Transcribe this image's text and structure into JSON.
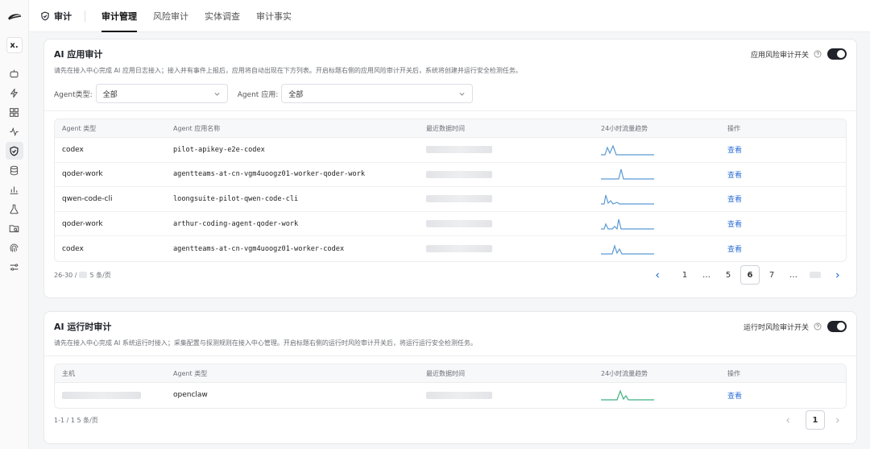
{
  "sidebar": {
    "workspace_initial": "x.",
    "items": [
      {
        "icon": "robot-icon"
      },
      {
        "icon": "lightning-icon"
      },
      {
        "icon": "grid-icon"
      },
      {
        "icon": "activity-icon"
      },
      {
        "icon": "shield-check-icon",
        "active": true
      },
      {
        "icon": "database-icon"
      },
      {
        "icon": "bar-chart-icon"
      },
      {
        "icon": "flask-icon"
      },
      {
        "icon": "folder-search-icon"
      },
      {
        "icon": "fingerprint-icon"
      },
      {
        "icon": "sliders-icon"
      }
    ]
  },
  "header": {
    "module": "审计",
    "tabs": [
      {
        "label": "审计管理",
        "active": true
      },
      {
        "label": "风险审计",
        "active": false
      },
      {
        "label": "实体调查",
        "active": false
      },
      {
        "label": "审计事实",
        "active": false
      }
    ]
  },
  "app_audit": {
    "title": "AI 应用审计",
    "switch_label": "应用风险审计开关",
    "switch_on": true,
    "description": "请先在接入中心完成 AI 应用日志接入；接入并有事件上报后，应用将自动出现在下方列表。开启标题右侧的应用风险审计开关后，系统将创建并运行安全检测任务。",
    "filter_type_label": "Agent类型:",
    "filter_type_value": "全部",
    "filter_app_label": "Agent 应用:",
    "filter_app_value": "全部",
    "columns": [
      "Agent 类型",
      "Agent 应用名称",
      "最近数据时间",
      "24小时流量趋势",
      "操作"
    ],
    "rows": [
      {
        "type": "codex",
        "name": "pilot-apikey-e2e-codex",
        "action": "查看"
      },
      {
        "type": "qoder-work",
        "name": "agentteams-at-cn-vgm4uoogz01-worker-qoder-work",
        "action": "查看"
      },
      {
        "type": "qwen-code-cli",
        "name": "loongsuite-pilot-qwen-code-cli",
        "action": "查看"
      },
      {
        "type": "qoder-work",
        "name": "arthur-coding-agent-qoder-work",
        "action": "查看"
      },
      {
        "type": "codex",
        "name": "agentteams-at-cn-vgm4uoogz01-worker-codex",
        "action": "查看"
      }
    ],
    "total_prefix": "26-30 /",
    "total_suffix": "5 条/页",
    "pages": [
      "1",
      "…",
      "5",
      "6",
      "7",
      "…"
    ],
    "current_page": "6"
  },
  "runtime_audit": {
    "title": "AI 运行时审计",
    "switch_label": "运行时风险审计开关",
    "switch_on": true,
    "description": "请先在接入中心完成 AI 系统运行时接入；采集配置与探测规则在接入中心管理。开启标题右侧的运行时风险审计开关后，将运行运行安全检测任务。",
    "columns": [
      "主机",
      "Agent 类型",
      "最近数据时间",
      "24小时流量趋势",
      "操作"
    ],
    "rows": [
      {
        "type": "openclaw",
        "action": "查看"
      }
    ],
    "total": "1-1 / 1  5 条/页",
    "current_page": "1"
  },
  "colors": {
    "accent": "#2f6fd6",
    "spark_blue": "#5b9bd5",
    "spark_green": "#3fb27f",
    "toggle": "#1f2329"
  }
}
